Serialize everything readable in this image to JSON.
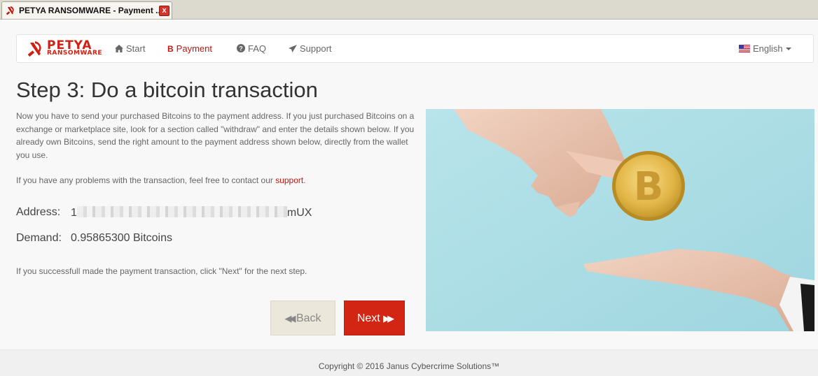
{
  "browser": {
    "tab_title": "PETYA RANSOMWARE - Payment ...",
    "tab_close": "x"
  },
  "navbar": {
    "logo_line1": "PETYA",
    "logo_line2": "RANSOMWARE",
    "items": [
      {
        "label": "Start",
        "icon": "home-icon"
      },
      {
        "label": "Payment",
        "icon": "bitcoin-icon",
        "active": true
      },
      {
        "label": "FAQ",
        "icon": "question-circle-icon"
      },
      {
        "label": "Support",
        "icon": "send-icon"
      }
    ],
    "language": "English"
  },
  "content": {
    "title": "Step 3: Do a bitcoin transaction",
    "intro": "Now you have to send your purchased Bitcoins to the payment address. If you just purchased Bitcoins on a exchange or marketplace site, look for a section called \"withdraw\" and enter the details shown below. If you already own Bitcoins, send the right amount to the payment address shown below, directly from the wallet you use.",
    "support_text": "If you have any problems with the transaction, feel free to contact our ",
    "support_link": "support",
    "support_end": ".",
    "address_label": "Address:",
    "address_prefix": "1",
    "address_suffix": "mUX",
    "demand_label": "Demand:",
    "demand_value": "0.95865300 Bitcoins",
    "next_hint": "If you successfull made the payment transaction, click \"Next\" for the next step."
  },
  "buttons": {
    "back": "Back",
    "next": "Next"
  },
  "footer": {
    "copyright": "Copyright © 2016 Janus Cybercrime Solutions™"
  },
  "colors": {
    "accent_red": "#d22514",
    "link_red": "#c0170f",
    "back_bg": "#ebe7da",
    "photo_bg": "#a9dde6"
  }
}
